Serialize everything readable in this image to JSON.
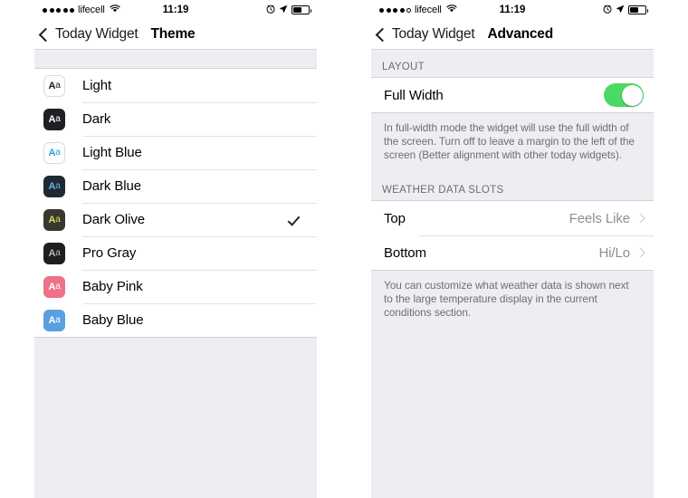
{
  "left_phone": {
    "status_bar": {
      "signal_dots_filled": 5,
      "signal_dots_hollow": 0,
      "carrier": "lifecell",
      "wifi_icon": "wifi-icon",
      "time": "11:19",
      "alarm_icon": "alarm-icon",
      "location_icon": "location-arrow-icon",
      "battery_icon": "battery-icon"
    },
    "nav": {
      "back_icon": "chevron-left-icon",
      "back_label": "Today Widget",
      "title": "Theme"
    },
    "themes": [
      {
        "label": "Light",
        "icon": "theme-swatch-icon",
        "bg": "#fdfdfd",
        "fg": "#1c1c1e",
        "border": "#dcdce0",
        "checked": false
      },
      {
        "label": "Dark",
        "icon": "theme-swatch-icon",
        "bg": "#1f2023",
        "fg": "#ffffff",
        "border": "#1f2023",
        "checked": false
      },
      {
        "label": "Light Blue",
        "icon": "theme-swatch-icon",
        "bg": "#fbfdfe",
        "fg": "#2f9fd0",
        "border": "#dcdce0",
        "checked": false
      },
      {
        "label": "Dark Blue",
        "icon": "theme-swatch-icon",
        "bg": "#1e2a33",
        "fg": "#64b5e0",
        "border": "#1e2a33",
        "checked": false
      },
      {
        "label": "Dark Olive",
        "icon": "theme-swatch-icon",
        "bg": "#38382e",
        "fg": "#d9db62",
        "border": "#38382e",
        "checked": true
      },
      {
        "label": "Pro Gray",
        "icon": "theme-swatch-icon",
        "bg": "#1e1e20",
        "fg": "#b9b9bd",
        "border": "#1e1e20",
        "checked": false
      },
      {
        "label": "Baby Pink",
        "icon": "theme-swatch-icon",
        "bg": "#ef7189",
        "fg": "#ffffff",
        "border": "#ef7189",
        "checked": false
      },
      {
        "label": "Baby Blue",
        "icon": "theme-swatch-icon",
        "bg": "#5c9fe0",
        "fg": "#ffffff",
        "border": "#5c9fe0",
        "checked": false
      }
    ]
  },
  "right_phone": {
    "status_bar": {
      "signal_dots_filled": 4,
      "signal_dots_hollow": 1,
      "carrier": "lifecell",
      "wifi_icon": "wifi-icon",
      "time": "11:19",
      "alarm_icon": "alarm-icon",
      "location_icon": "location-arrow-icon",
      "battery_icon": "battery-icon"
    },
    "nav": {
      "back_icon": "chevron-left-icon",
      "back_label": "Today Widget",
      "title": "Advanced"
    },
    "layout_section": {
      "header": "LAYOUT",
      "full_width": {
        "label": "Full Width",
        "toggle_on": true,
        "toggle_color": "#4CD864"
      },
      "footer": "In full-width mode the widget will use the full width of the screen. Turn off to leave a margin to the left of the screen (Better alignment with other today widgets)."
    },
    "weather_section": {
      "header": "WEATHER DATA SLOTS",
      "rows": [
        {
          "label": "Top",
          "value": "Feels Like",
          "chevron": "chevron-right-icon"
        },
        {
          "label": "Bottom",
          "value": "Hi/Lo",
          "chevron": "chevron-right-icon"
        }
      ],
      "footer": "You can customize what weather data is shown next to the large temperature display in the current conditions section."
    }
  }
}
